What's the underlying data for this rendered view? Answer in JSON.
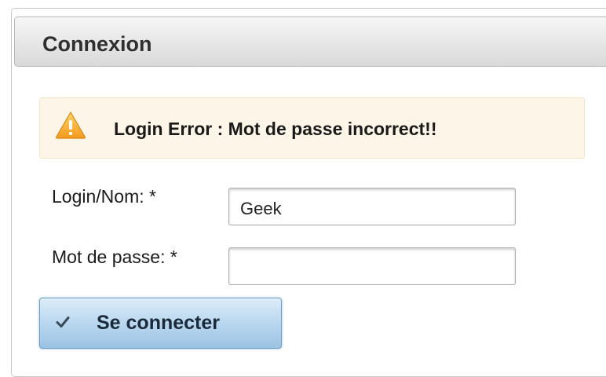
{
  "panel": {
    "title": "Connexion"
  },
  "alert": {
    "icon": "warning-icon",
    "message": "Login Error : Mot de passe incorrect!!",
    "background_color": "#fdf6e8",
    "icon_color": "#f5a623"
  },
  "form": {
    "login": {
      "label": "Login/Nom: *",
      "value": "Geek"
    },
    "password": {
      "label": "Mot de passe: *",
      "value": ""
    },
    "submit": {
      "icon": "checkmark-icon",
      "label": "Se connecter",
      "color": "#b9d7ef"
    }
  }
}
